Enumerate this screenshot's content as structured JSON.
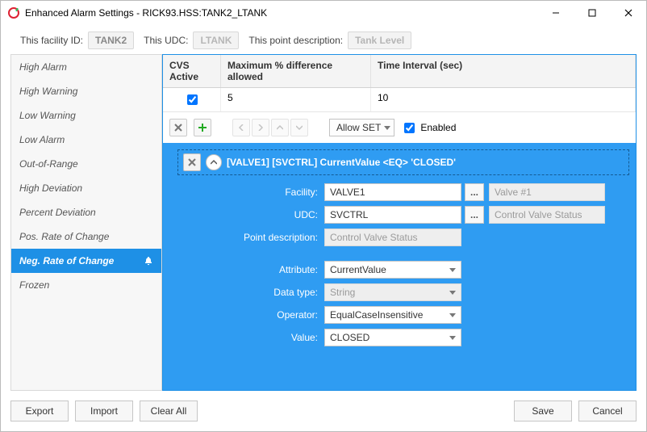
{
  "window": {
    "title": "Enhanced Alarm Settings - RICK93.HSS:TANK2_LTANK"
  },
  "toprow": {
    "facility_label": "This facility ID:",
    "facility_value": "TANK2",
    "udc_label": "This UDC:",
    "udc_value": "LTANK",
    "pdesc_label": "This point description:",
    "pdesc_value": "Tank Level"
  },
  "sidebar": {
    "items": [
      {
        "label": "High Alarm"
      },
      {
        "label": "High Warning"
      },
      {
        "label": "Low Warning"
      },
      {
        "label": "Low Alarm"
      },
      {
        "label": "Out-of-Range"
      },
      {
        "label": "High Deviation"
      },
      {
        "label": "Percent Deviation"
      },
      {
        "label": "Pos. Rate of Change"
      },
      {
        "label": "Neg. Rate of Change"
      },
      {
        "label": "Frozen"
      }
    ],
    "selected_index": 8
  },
  "grid": {
    "headers": {
      "c1": "CVS Active",
      "c2": "Maximum % difference allowed",
      "c3": "Time Interval (sec)"
    },
    "row": {
      "active": true,
      "maxpct": "5",
      "interval": "10"
    }
  },
  "toolbar": {
    "allowset_label": "Allow SET",
    "enabled_label": "Enabled",
    "enabled_checked": true
  },
  "expr": {
    "text": "[VALVE1] [SVCTRL] CurrentValue <EQ> 'CLOSED'"
  },
  "form": {
    "facility_label": "Facility:",
    "facility_value": "VALVE1",
    "facility_desc": "Valve #1",
    "udc_label": "UDC:",
    "udc_value": "SVCTRL",
    "udc_desc": "Control Valve Status",
    "pdesc_label": "Point description:",
    "pdesc_value": "Control Valve Status",
    "attr_label": "Attribute:",
    "attr_value": "CurrentValue",
    "dtype_label": "Data type:",
    "dtype_value": "String",
    "op_label": "Operator:",
    "op_value": "EqualCaseInsensitive",
    "val_label": "Value:",
    "val_value": "CLOSED"
  },
  "footer": {
    "export": "Export",
    "import": "Import",
    "clear": "Clear All",
    "save": "Save",
    "cancel": "Cancel"
  }
}
